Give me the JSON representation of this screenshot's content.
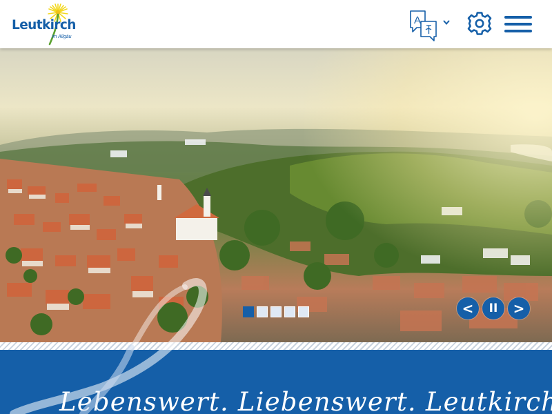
{
  "header": {
    "logo": {
      "name": "Leutkirch",
      "subtitle": "im Allgäu",
      "icon": "dandelion-icon"
    },
    "language_button": {
      "icon": "translate-icon",
      "chevron_icon": "chevron-down-icon"
    },
    "settings_button": {
      "icon": "gear-icon"
    },
    "menu_button": {
      "icon": "hamburger-menu-icon"
    }
  },
  "hero": {
    "image_description_visible": false,
    "slides": {
      "total": 5,
      "active_index": 0
    },
    "controls": {
      "prev_label": "<",
      "pause_label": "II",
      "next_label": ">"
    }
  },
  "banner": {
    "slogan": "Lebenswert. Liebenswert. Leutkirch."
  },
  "colors": {
    "brand_blue": "#155fa8",
    "flower_yellow": "#f3d81e",
    "stem_green": "#5aa12f",
    "white": "#ffffff"
  }
}
